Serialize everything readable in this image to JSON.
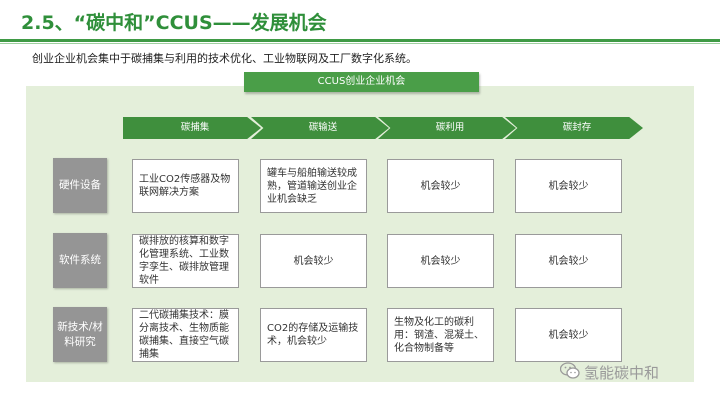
{
  "title": "2.5、“碳中和”CCUS——发展机会",
  "subtitle": "创业企业机会集中于碳捕集与利用的技术优化、工业物联网及工厂数字化系统。",
  "banner": "CCUS创业企业机会",
  "stages": [
    "碳捕集",
    "碳输送",
    "碳利用",
    "碳封存"
  ],
  "rows": [
    {
      "label": "硬件设备",
      "cells": [
        "工业CO2传感器及物联网解决方案",
        "罐车与船舶输送较成熟，管道输送创业企业机会缺乏",
        "机会较少",
        "机会较少"
      ]
    },
    {
      "label": "软件系统",
      "cells": [
        "碳排放的核算和数字化管理系统、工业数字孪生、碳排放管理软件",
        "机会较少",
        "机会较少",
        "机会较少"
      ]
    },
    {
      "label": "新技术/材料研究",
      "cells": [
        "二代碳捕集技术：膜分离技术、生物质能碳捕集、直接空气碳捕集",
        "CO2的存储及运输技术，机会较少",
        "生物及化工的碳利用：钢渣、混凝土、化合物制备等",
        "机会较少"
      ]
    }
  ],
  "watermark": "氢能碳中和",
  "colors": {
    "accent": "#2f8f3a",
    "chevron": "#3f8f3d",
    "panel": "#e4efda",
    "rowhead": "#959595"
  }
}
